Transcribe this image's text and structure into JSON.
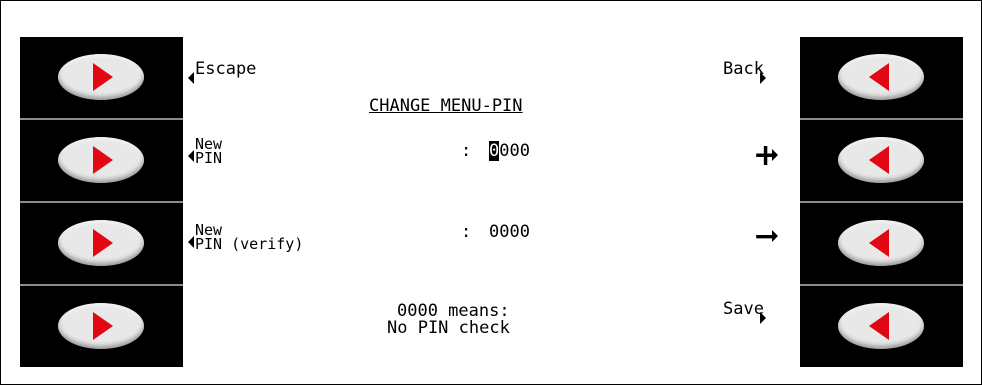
{
  "screen": {
    "title": "CHANGE MENU-PIN",
    "left_labels": {
      "escape": "Escape",
      "new_pin_line1": "New",
      "new_pin_line2": "PIN",
      "verify_line1": "New",
      "verify_line2": "PIN (verify)"
    },
    "right_labels": {
      "back": "Back",
      "plus": "+",
      "minus": "−",
      "save": "Save"
    },
    "fields": {
      "new_pin_separator": ":",
      "new_pin_cursor_digit": "0",
      "new_pin_rest": "000",
      "verify_separator": ":",
      "verify_value": "0000"
    },
    "note": {
      "line1": "0000 means:",
      "line2": "No PIN check"
    }
  },
  "colors": {
    "bezel": "#000000",
    "divider": "#8c8c8c",
    "button_face": "#e8e8e8",
    "arrow": "#e30613",
    "display_bg": "#ffffff",
    "display_fg": "#000000"
  },
  "icons": {
    "left_softkeys": "arrow-right-icon",
    "right_softkeys": "arrow-left-icon"
  }
}
